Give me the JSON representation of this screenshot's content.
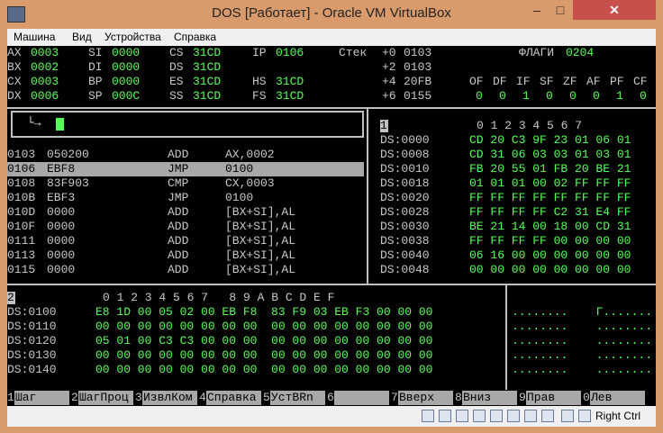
{
  "window": {
    "title": "DOS [Работает] - Oracle VM VirtualBox",
    "minimize": "–",
    "maximize": "□",
    "close": "✕"
  },
  "menu": [
    "Машина",
    "Вид",
    "Устройства",
    "Справка"
  ],
  "registers": {
    "row1": [
      "AX",
      "0003",
      "SI",
      "0000",
      "CS",
      "31CD",
      "IP",
      "0106"
    ],
    "row2": [
      "BX",
      "0002",
      "DI",
      "0000",
      "DS",
      "31CD"
    ],
    "row3": [
      "CX",
      "0003",
      "BP",
      "0000",
      "ES",
      "31CD",
      "HS",
      "31CD"
    ],
    "row4": [
      "DX",
      "0006",
      "SP",
      "000C",
      "SS",
      "31CD",
      "FS",
      "31CD"
    ]
  },
  "stack": {
    "label": "Стек",
    "rows": [
      [
        "+0",
        "0103"
      ],
      [
        "+2",
        "0103"
      ],
      [
        "+4",
        "20FB"
      ],
      [
        "+6",
        "0155"
      ]
    ]
  },
  "flags": {
    "label": "ФЛАГИ",
    "value": "0204",
    "names": [
      "OF",
      "DF",
      "IF",
      "SF",
      "ZF",
      "AF",
      "PF",
      "CF"
    ],
    "values": [
      "0",
      "0",
      "1",
      "0",
      "0",
      "0",
      "1",
      "0"
    ]
  },
  "command": {
    "prompt": "└→"
  },
  "disasm": [
    [
      "0103",
      "050200",
      "ADD",
      "AX,0002"
    ],
    [
      "0106",
      "EBF8",
      "JMP",
      "0100"
    ],
    [
      "0108",
      "83F903",
      "CMP",
      "CX,0003"
    ],
    [
      "010B",
      "EBF3",
      "JMP",
      "0100"
    ],
    [
      "010D",
      "0000",
      "ADD",
      "[BX+SI],AL"
    ],
    [
      "010F",
      "0000",
      "ADD",
      "[BX+SI],AL"
    ],
    [
      "0111",
      "0000",
      "ADD",
      "[BX+SI],AL"
    ],
    [
      "0113",
      "0000",
      "ADD",
      "[BX+SI],AL"
    ],
    [
      "0115",
      "0000",
      "ADD",
      "[BX+SI],AL"
    ]
  ],
  "dump1": {
    "window_no": "1",
    "header": "0 1 2 3 4 5 6 7",
    "rows": [
      [
        "DS:0000",
        "CD 20 C3 9F 23 01 06 01"
      ],
      [
        "DS:0008",
        "CD 31 06 03 03 01 03 01"
      ],
      [
        "DS:0010",
        "FB 20 55 01 FB 20 BE 21"
      ],
      [
        "DS:0018",
        "01 01 01 00 02 FF FF FF"
      ],
      [
        "DS:0020",
        "FF FF FF FF FF FF FF FF"
      ],
      [
        "DS:0028",
        "FF FF FF FF C2 31 E4 FF"
      ],
      [
        "DS:0030",
        "BE 21 14 00 18 00 CD 31"
      ],
      [
        "DS:0038",
        "FF FF FF FF 00 00 00 00"
      ],
      [
        "DS:0040",
        "06 16 00 00 00 00 00 00"
      ],
      [
        "DS:0048",
        "00 00 00 00 00 00 00 00"
      ]
    ]
  },
  "dump2": {
    "window_no": "2",
    "header": "0 1 2 3 4 5 6 7   8 9 A B C D E F",
    "rows": [
      [
        "DS:0100",
        "E8 1D 00 05 02 00 EB F8  83 F9 03 EB F3 00 00 00",
        "........    Г......."
      ],
      [
        "DS:0110",
        "00 00 00 00 00 00 00 00  00 00 00 00 00 00 00 00",
        "........    ........"
      ],
      [
        "DS:0120",
        "05 01 00 C3 C3 00 00 00  00 00 00 00 00 00 00 00",
        "........    ........"
      ],
      [
        "DS:0130",
        "00 00 00 00 00 00 00 00  00 00 00 00 00 00 00 00",
        "........    ........"
      ],
      [
        "DS:0140",
        "00 00 00 00 00 00 00 00  00 00 00 00 00 00 00 00",
        "........    ........"
      ]
    ]
  },
  "fkeys": [
    [
      "1",
      "Шаг"
    ],
    [
      "2",
      "ШагПроц"
    ],
    [
      "3",
      "ИзвлКом"
    ],
    [
      "4",
      "Справка"
    ],
    [
      "5",
      "УстBRn"
    ],
    [
      "6",
      ""
    ],
    [
      "7",
      "Вверх"
    ],
    [
      "8",
      "Вниз"
    ],
    [
      "9",
      "Прав"
    ],
    [
      "0",
      "Лев"
    ]
  ],
  "status": {
    "hostkey": "Right Ctrl"
  }
}
